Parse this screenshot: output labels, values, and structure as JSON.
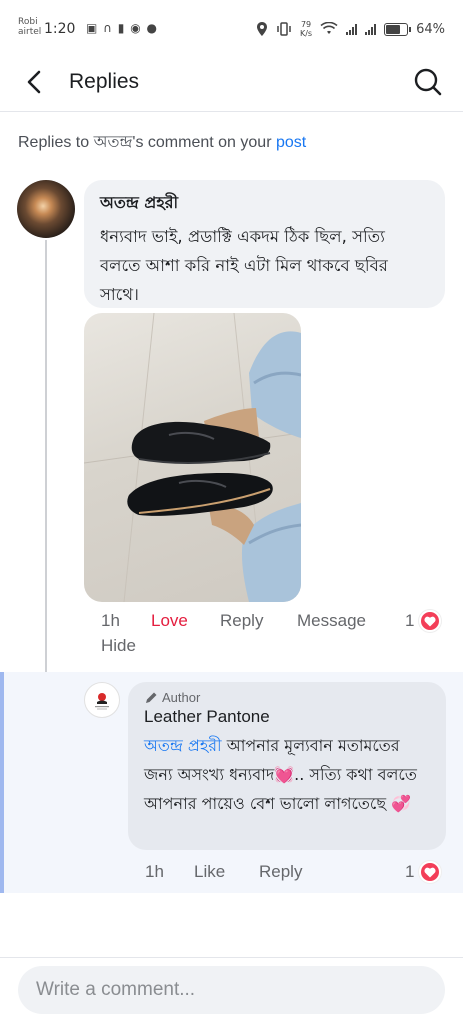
{
  "status_bar": {
    "carrier_line1": "Robi",
    "carrier_line2": "airtel",
    "time": "1:20",
    "net_speed_value": "79",
    "net_speed_unit": "K/s",
    "battery": "64%"
  },
  "header": {
    "title": "Replies",
    "back_icon": "chevron-left-icon",
    "search_icon": "search-icon"
  },
  "context": {
    "prefix": "Replies to ",
    "name": "অতন্দ্র",
    "middle": "'s comment on your ",
    "link": "post"
  },
  "comment": {
    "author": "অতন্দ্র প্রহরী",
    "text": "ধন্যবাদ ভাই, প্রডাক্টি একদম ঠিক ছিল, সত্যি বলতে আশা করি নাই এটা মিল থাকবে ছবির সাথে।",
    "time": "1h",
    "reaction_label": "Love",
    "reply_label": "Reply",
    "message_label": "Message",
    "hide_label": "Hide",
    "reaction_count": "1",
    "reaction_icon": "heart-icon"
  },
  "reply": {
    "badge": "Author",
    "badge_icon": "pencil-icon",
    "author": "Leather Pantone",
    "mention": "অতন্দ্র প্রহরী",
    "text": " আপনার মূল্যবান মতামতের জন্য অসংখ্য ধন্যবাদ💓.. সত্যি কথা বলতে আপনার পায়েও বেশ ভালো লাগতেছে 💞",
    "time": "1h",
    "like_label": "Like",
    "reply_label": "Reply",
    "reaction_count": "1",
    "reaction_icon": "heart-icon"
  },
  "composer": {
    "placeholder": "Write a comment..."
  },
  "colors": {
    "accent": "#1877f2",
    "love": "#e41e3f",
    "heart_badge": "#f33e58",
    "reply_highlight": "#f3f6fc"
  }
}
